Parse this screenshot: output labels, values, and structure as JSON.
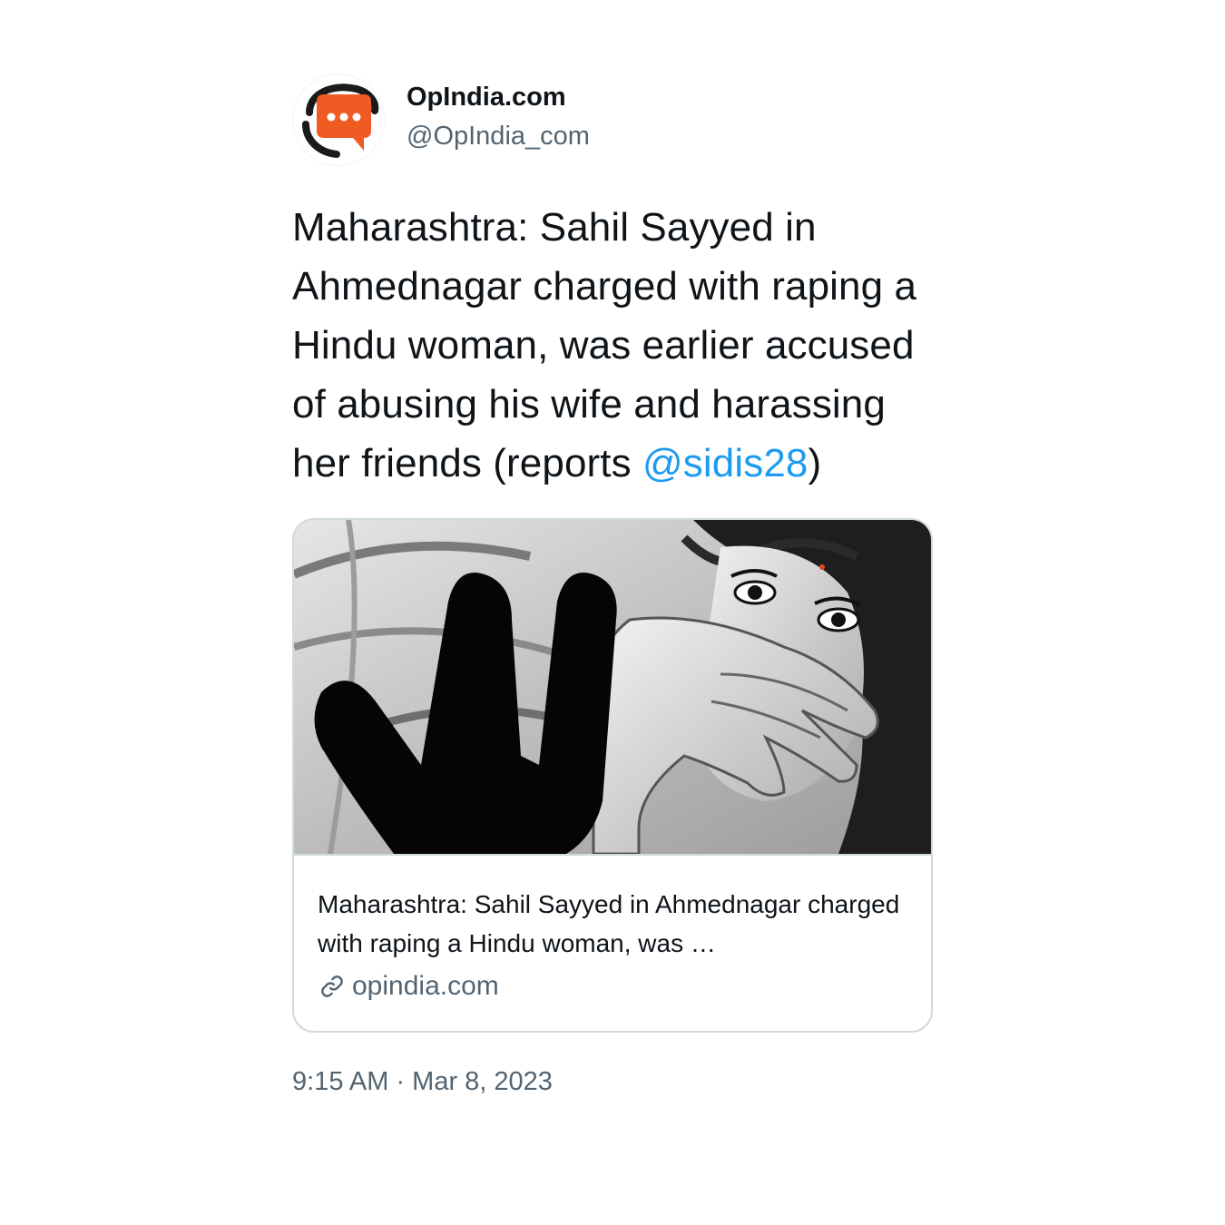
{
  "author": {
    "display_name": "OpIndia.com",
    "handle": "@OpIndia_com",
    "avatar_icon": "opindia-logo-icon",
    "brand_color": "#f15a22"
  },
  "tweet": {
    "text_before_mention": "Maharashtra: Sahil Sayyed in Ahmednagar charged with raping a Hindu woman, was earlier accused of abusing his wife and harassing her friends (reports ",
    "mention": "@sidis28",
    "text_after_mention": ")",
    "mention_color": "#1d9bf0"
  },
  "link_card": {
    "image_icon": "hand-covering-mouth-illustration",
    "title": "Maharashtra: Sahil Sayyed in Ahmednagar charged with raping a Hindu woman, was …",
    "domain": "opindia.com",
    "domain_icon": "link-icon"
  },
  "meta": {
    "timestamp": "9:15 AM · Mar 8, 2023"
  }
}
